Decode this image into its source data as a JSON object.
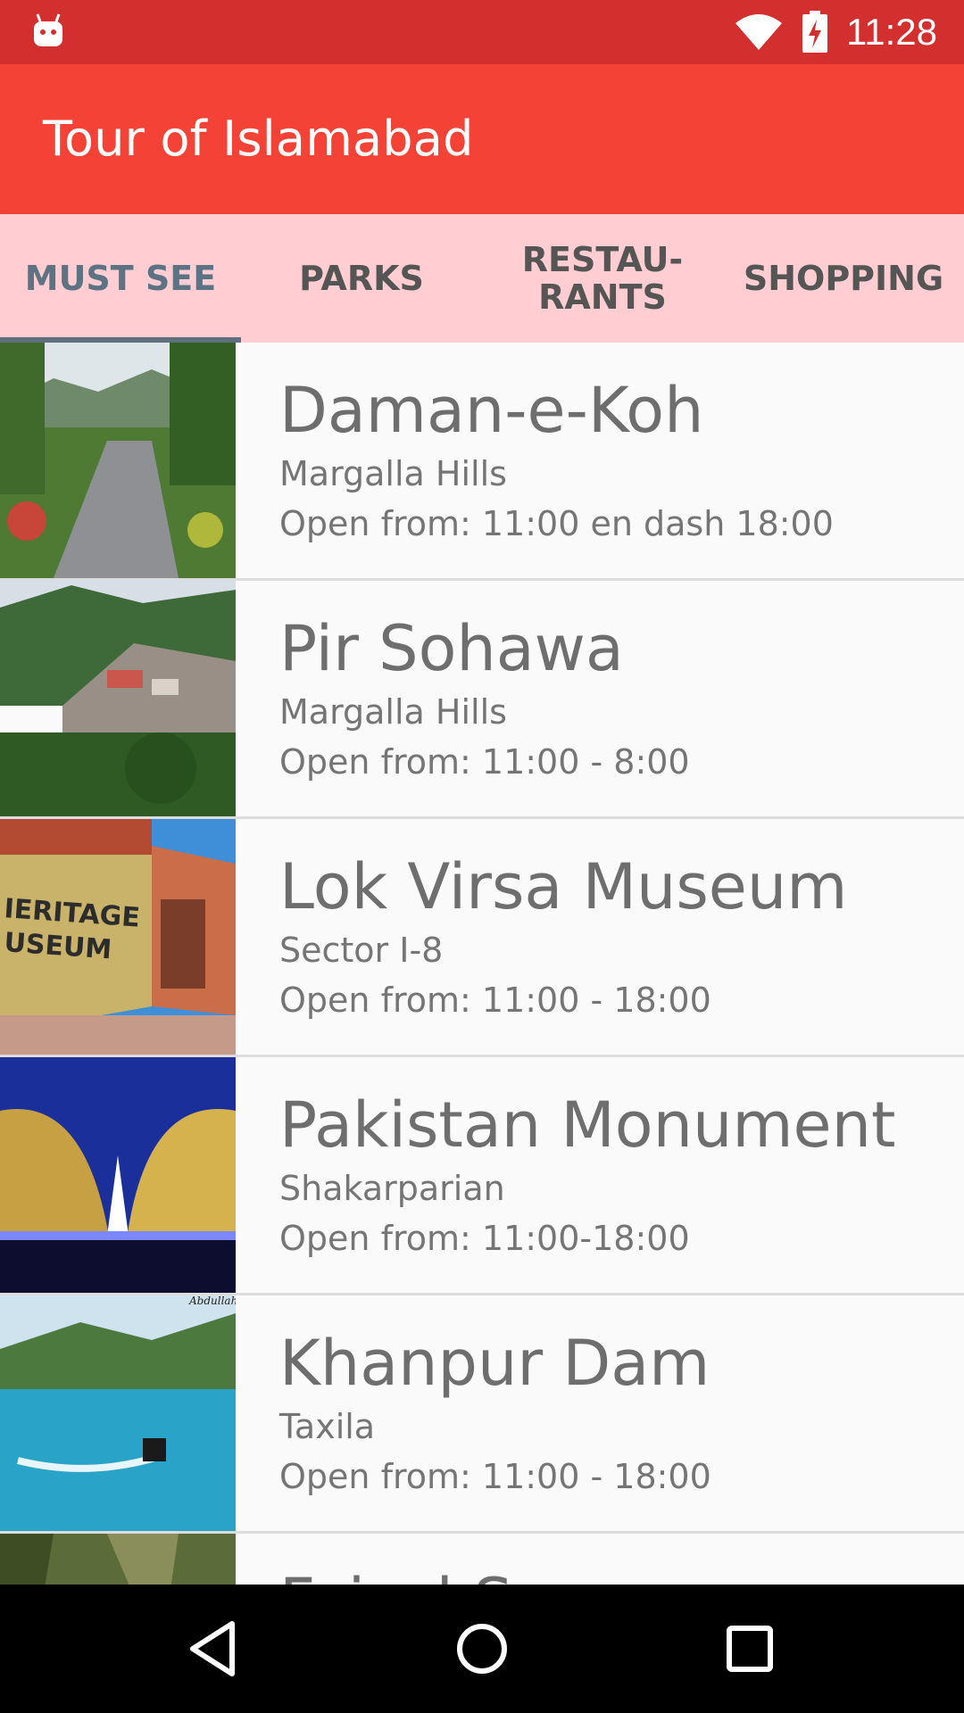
{
  "status_bar": {
    "time": "11:28",
    "icons": [
      "debug-icon",
      "wifi-icon",
      "battery-charging-icon"
    ],
    "color": "#d32f2f"
  },
  "app_bar": {
    "title": "Tour of Islamabad",
    "color": "#f44336"
  },
  "tabs": {
    "active_index": 0,
    "indicator_color": "#5f6f7d",
    "background": "#ffcdd2",
    "items": [
      {
        "label": "MUST SEE"
      },
      {
        "label": "PARKS"
      },
      {
        "label": "RESTAU-\nRANTS"
      },
      {
        "label": "SHOPPING"
      }
    ]
  },
  "places": [
    {
      "name": "Daman-e-Koh",
      "area": "Margalla Hills",
      "hours": "Open from: 11:00 en dash 18:00",
      "image": "park-road-hills-photo"
    },
    {
      "name": "Pir Sohawa",
      "area": "Margalla Hills",
      "hours": "Open from: 11:00 - 8:00",
      "image": "hillside-village-photo"
    },
    {
      "name": "Lok Virsa Museum",
      "area": "Sector I-8",
      "hours": "Open from: 11:00 - 18:00",
      "image": "heritage-museum-photo"
    },
    {
      "name": "Pakistan Monument",
      "area": "Shakarparian",
      "hours": "Open from: 11:00-18:00",
      "image": "monument-night-photo"
    },
    {
      "name": "Khanpur Dam",
      "area": "Taxila",
      "hours": "Open from: 11:00 - 18:00",
      "image": "lake-jetski-photo",
      "image_watermark": "Abdullah"
    },
    {
      "name": "Faisal Square",
      "area": "",
      "hours": "",
      "image": "forest-photo"
    }
  ],
  "nav_bar": {
    "buttons": [
      "back-icon",
      "home-icon",
      "recents-icon"
    ]
  }
}
